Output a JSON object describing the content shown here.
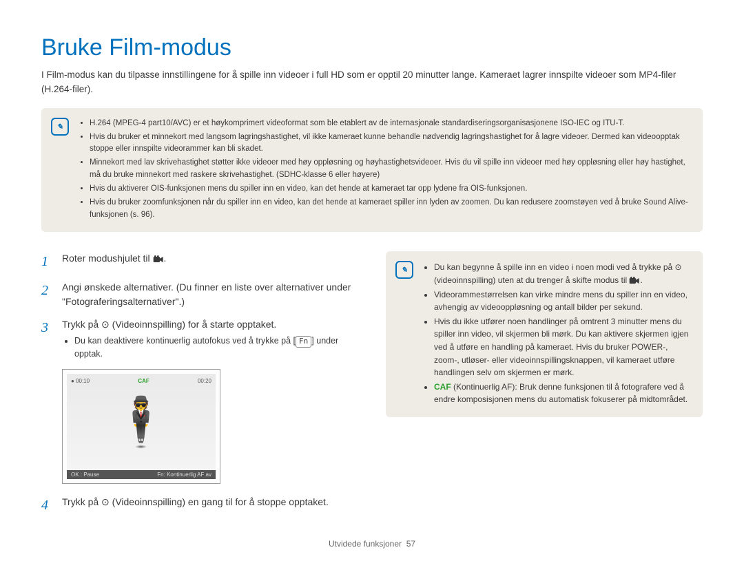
{
  "title": "Bruke Film-modus",
  "intro": "I Film-modus kan du tilpasse innstillingene for å spille inn videoer i full HD som er opptil 20 minutter lange. Kameraet lagrer innspilte videoer som MP4-filer (H.264-filer).",
  "top_notes": [
    "H.264 (MPEG-4 part10/AVC) er et høykomprimert videoformat som ble etablert av de internasjonale standardiseringsorganisasjonene ISO-IEC og ITU-T.",
    "Hvis du bruker et minnekort med langsom lagringshastighet, vil ikke kameraet kunne behandle nødvendig lagringshastighet for å lagre videoer. Dermed kan videoopptak stoppe eller innspilte videorammer kan bli skadet.",
    "Minnekort med lav skrivehastighet støtter ikke videoer med høy oppløsning og høyhastighetsvideoer. Hvis du vil spille inn videoer med høy oppløsning eller høy hastighet, må du bruke minnekort med raskere skrivehastighet. (SDHC-klasse 6 eller høyere)",
    "Hvis du aktiverer OIS-funksjonen mens du spiller inn en video, kan det hende at kameraet tar opp lydene fra OIS-funksjonen.",
    "Hvis du bruker zoomfunksjonen når du spiller inn en video, kan det hende at kameraet spiller inn lyden av zoomen. Du kan redusere zoomstøyen ved å bruke Sound Alive-funksjonen (s. 96)."
  ],
  "steps": {
    "s1": "Roter modushjulet til ",
    "s2": "Angi ønskede alternativer. (Du finner en liste over alternativer under \"Fotograferingsalternativer\".)",
    "s3": "Trykk på ⊙ (Videoinnspilling) for å starte opptaket.",
    "s3_sub_a": "Du kan deaktivere kontinuerlig autofokus ved å trykke på ",
    "s3_sub_b": " under opptak.",
    "s4": "Trykk på ⊙ (Videoinnspilling) en gang til for å stoppe opptaket."
  },
  "fn_key": "Fn",
  "screen": {
    "rec_time": "00:10",
    "total_time": "00:20",
    "caf": "CAF",
    "bar_left": "OK : Pause",
    "bar_right": "Fn: Kontinuerlig AF av"
  },
  "right_notes": {
    "n1_a": "Du kan begynne å spille inn en video i noen modi ved å trykke på ⊙ (videoinnspilling) uten at du trenger å skifte modus til ",
    "n1_b": ".",
    "n2": "Videorammestørrelsen kan virke mindre mens du spiller inn en video, avhengig av videooppløsning og antall bilder per sekund.",
    "n3": "Hvis du ikke utfører noen handlinger på omtrent 3 minutter mens du spiller inn video, vil skjermen bli mørk. Du kan aktivere skjermen igjen ved å utføre en handling på kameraet. Hvis du bruker POWER-, zoom-, utløser- eller videoinnspillingsknappen, vil kameraet utføre handlingen selv om skjermen er mørk.",
    "n4_label": "CAF",
    "n4_body": " (Kontinuerlig AF): Bruk denne funksjonen til å fotografere ved å endre komposisjonen mens du automatisk fokuserer på midtområdet."
  },
  "footer": {
    "section": "Utvidede funksjoner",
    "page": "57"
  }
}
